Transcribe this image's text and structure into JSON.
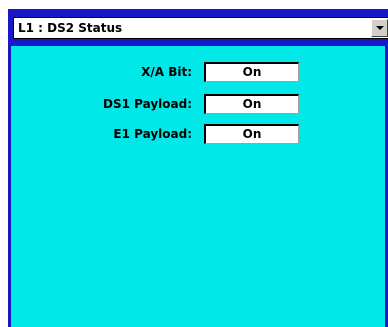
{
  "header": {
    "selected_option": "L1 : DS2 Status"
  },
  "rows": [
    {
      "label": "X/A Bit:",
      "value": "On"
    },
    {
      "label": "DS1 Payload:",
      "value": "On"
    },
    {
      "label": "E1 Payload:",
      "value": "On"
    }
  ],
  "colors": {
    "panel_background": "#00e8e8",
    "header_bar": "#1818c8",
    "field_background": "#ffffff"
  },
  "icons": {
    "dropdown": "chevron-down-icon"
  }
}
